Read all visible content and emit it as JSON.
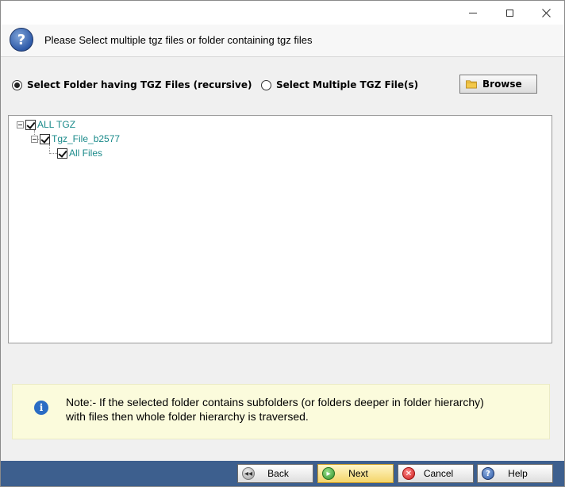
{
  "header": {
    "text": "Please Select multiple tgz files or folder containing tgz files",
    "icon": "help-circle-icon"
  },
  "options": {
    "folder_label": "Select Folder having TGZ Files (recursive)",
    "folder_selected": true,
    "files_label": "Select Multiple TGZ File(s)",
    "files_selected": false,
    "browse_label": "Browse"
  },
  "tree": {
    "root": "ALL TGZ",
    "child": "Tgz_File_b2577",
    "grandchild": "All Files"
  },
  "note": {
    "line1": "Note:- If the selected folder contains subfolders (or folders deeper in folder hierarchy)",
    "line2": "with files then whole folder hierarchy is traversed."
  },
  "footer": {
    "back_label": "Back",
    "next_label": "Next",
    "cancel_label": "Cancel",
    "help_label": "Help"
  },
  "colors": {
    "tree_text": "#1a8a8a",
    "footer_bar": "#3d5f8e",
    "note_bg": "#fbfbdc",
    "next_button": "#f4d56a"
  }
}
